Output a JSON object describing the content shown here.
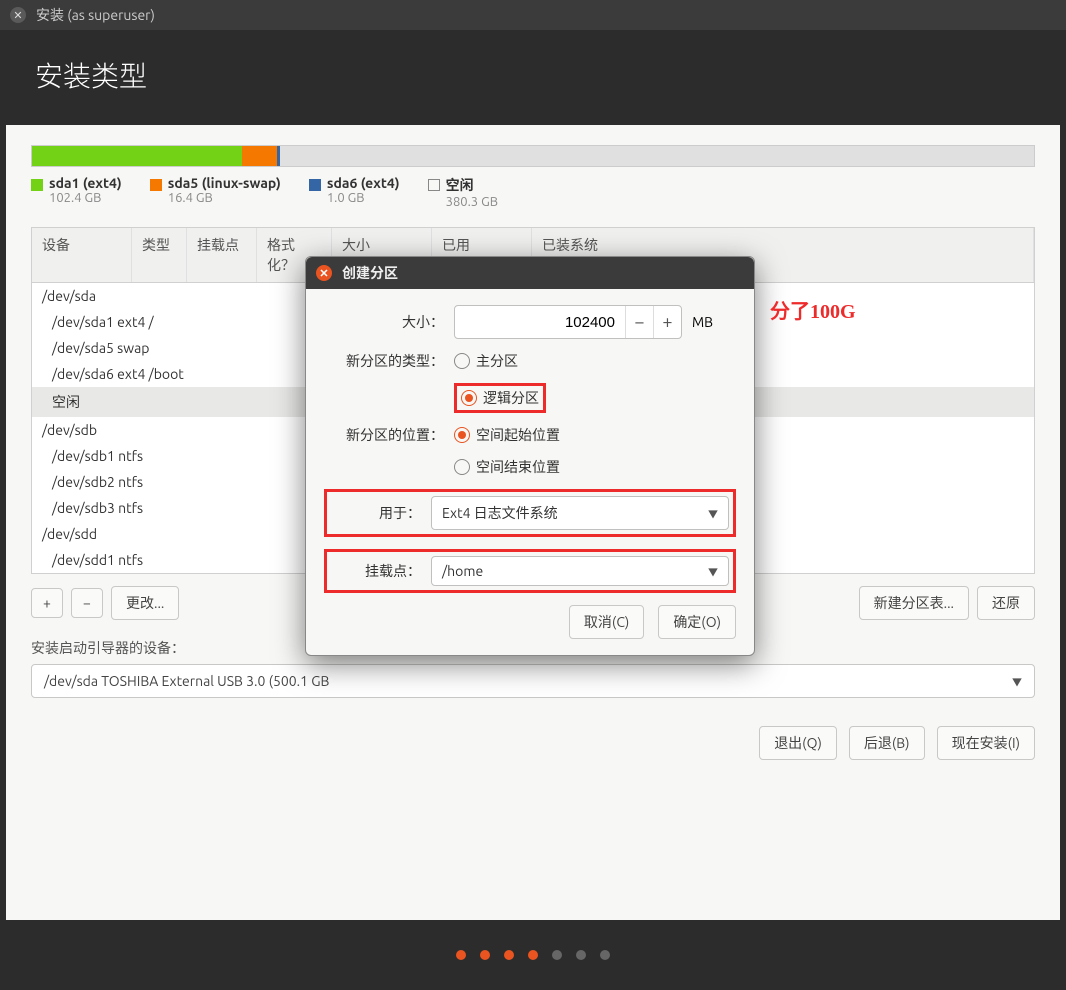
{
  "window": {
    "title": "安装 (as superuser)",
    "heading": "安装类型"
  },
  "usage": {
    "segments": [
      {
        "cls": "green",
        "pct": 21
      },
      {
        "cls": "orange",
        "pct": 3.5
      },
      {
        "cls": "blue",
        "pct": 0.3
      }
    ]
  },
  "legend": [
    {
      "cls": "green",
      "name": "sda1 (ext4)",
      "size": "102.4 GB"
    },
    {
      "cls": "orange",
      "name": "sda5 (linux-swap)",
      "size": "16.4 GB"
    },
    {
      "cls": "blue",
      "name": "sda6 (ext4)",
      "size": "1.0 GB"
    },
    {
      "cls": "empty",
      "name": "空闲",
      "size": "380.3 GB"
    }
  ],
  "columns": [
    "设备",
    "类型",
    "挂载点",
    "格式化？",
    "大小",
    "已用",
    "已装系统"
  ],
  "rows": [
    {
      "text": "/dev/sda",
      "indent": false
    },
    {
      "text": "/dev/sda1  ext4   /",
      "indent": true
    },
    {
      "text": "/dev/sda5  swap",
      "indent": true
    },
    {
      "text": "/dev/sda6  ext4   /boot",
      "indent": true
    },
    {
      "text": "空闲",
      "indent": true,
      "sel": true
    },
    {
      "text": "/dev/sdb",
      "indent": false
    },
    {
      "text": "/dev/sdb1  ntfs",
      "indent": true
    },
    {
      "text": "/dev/sdb2  ntfs",
      "indent": true
    },
    {
      "text": "/dev/sdb3  ntfs",
      "indent": true
    },
    {
      "text": "/dev/sdd",
      "indent": false
    },
    {
      "text": "/dev/sdd1  ntfs",
      "indent": true
    }
  ],
  "toolbar": {
    "plus": "+",
    "minus": "−",
    "change": "更改...",
    "newtable": "新建分区表...",
    "revert": "还原"
  },
  "boot": {
    "label": "安装启动引导器的设备：",
    "value": "/dev/sda   TOSHIBA External USB 3.0 (500.1 GB"
  },
  "bottom": {
    "quit": "退出(Q)",
    "back": "后退(B)",
    "install": "现在安装(I)"
  },
  "dialog": {
    "title": "创建分区",
    "size_label": "大小：",
    "size_value": "102400",
    "size_unit": "MB",
    "type_label": "新分区的类型：",
    "type_primary": "主分区",
    "type_logical": "逻辑分区",
    "pos_label": "新分区的位置：",
    "pos_begin": "空间起始位置",
    "pos_end": "空间结束位置",
    "use_label": "用于：",
    "use_value": "Ext4 日志文件系统",
    "mount_label": "挂载点：",
    "mount_value": "/home",
    "cancel": "取消(C)",
    "ok": "确定(O)"
  },
  "annotation": "分了100G"
}
